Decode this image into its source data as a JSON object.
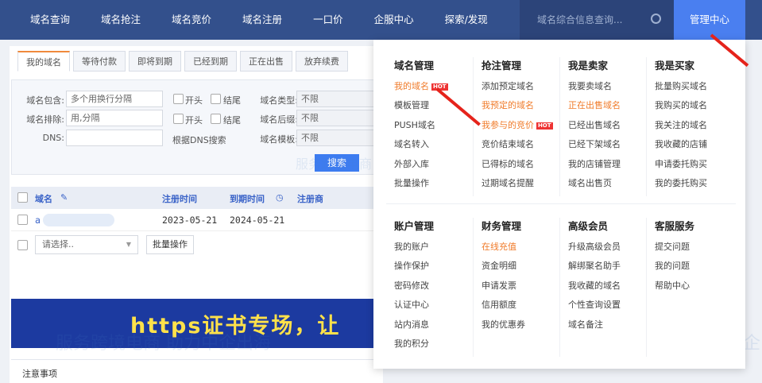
{
  "nav": {
    "items": [
      "域名查询",
      "域名抢注",
      "域名竞价",
      "域名注册",
      "一口价",
      "企服中心",
      "探索/发现"
    ],
    "search_placeholder": "域名综合信息查询...",
    "manage": "管理中心"
  },
  "tabs": [
    "我的域名",
    "等待付款",
    "即将到期",
    "已经到期",
    "正在出售",
    "放弃续费"
  ],
  "filter": {
    "include_label": "域名包含:",
    "include_ph": "多个用换行分隔",
    "exclude_label": "域名排除:",
    "exclude_ph": "用,分隔",
    "dns_label": "DNS:",
    "start": "开头",
    "end": "结尾",
    "dns_search": "根据DNS搜索",
    "type_label": "域名类型:",
    "suffix_label": "域名后缀:",
    "template_label": "域名模板:",
    "any": "不限",
    "search": "搜索"
  },
  "table": {
    "headers": [
      "域名",
      "注册时间",
      "到期时间",
      "注册商"
    ],
    "rows": [
      {
        "domain": "a",
        "reg": "2023-05-21",
        "exp": "2024-05-21"
      }
    ],
    "select": "请选择..",
    "batch": "批量操作"
  },
  "banner": "https证书专场，让",
  "note": "注意事项",
  "menu": {
    "sections": [
      [
        {
          "title": "域名管理",
          "items": [
            "我的域名",
            "模板管理",
            "PUSH域名",
            "域名转入",
            "外部入库",
            "批量操作"
          ]
        },
        {
          "title": "抢注管理",
          "items": [
            "添加预定域名",
            "我预定的域名",
            "我参与的竞价",
            "竞价结束域名",
            "已得标的域名",
            "过期域名提醒"
          ]
        },
        {
          "title": "我是卖家",
          "items": [
            "我要卖域名",
            "正在出售域名",
            "已经出售域名",
            "已经下架域名",
            "我的店铺管理",
            "域名出售页"
          ]
        },
        {
          "title": "我是买家",
          "items": [
            "批量购买域名",
            "我购买的域名",
            "我关注的域名",
            "我收藏的店铺",
            "申请委托购买",
            "我的委托购买"
          ]
        }
      ],
      [
        {
          "title": "账户管理",
          "items": [
            "我的账户",
            "操作保护",
            "密码修改",
            "认证中心",
            "站内消息",
            "我的积分"
          ]
        },
        {
          "title": "财务管理",
          "items": [
            "在线充值",
            "资金明细",
            "申请发票",
            "信用额度",
            "我的优惠券"
          ]
        },
        {
          "title": "高级会员",
          "items": [
            "升级高级会员",
            "解绑聚名助手",
            "我收藏的域名",
            "个性查询设置",
            "域名备注"
          ]
        },
        {
          "title": "客服服务",
          "items": [
            "提交问题",
            "我的问题",
            "帮助中心"
          ]
        }
      ]
    ],
    "hot": "HOT"
  },
  "watermark": "服务跨境电商 助力中企出海"
}
